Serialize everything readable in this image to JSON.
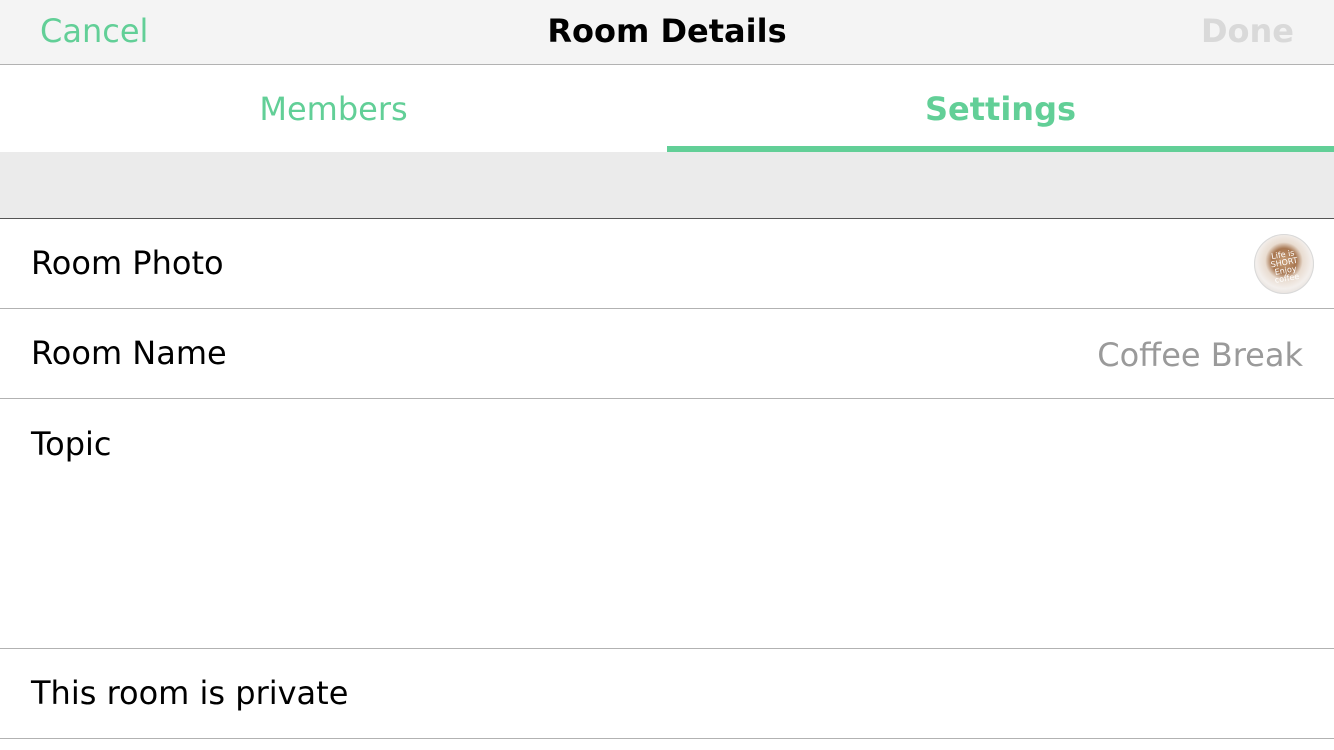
{
  "navbar": {
    "cancel_label": "Cancel",
    "title": "Room Details",
    "done_label": "Done"
  },
  "tabs": [
    {
      "label": "Members",
      "selected": false
    },
    {
      "label": "Settings",
      "selected": true
    }
  ],
  "settings": {
    "room_photo": {
      "label": "Room Photo",
      "avatar_text": "Life is SHORT Enjoy coffee"
    },
    "room_name": {
      "label": "Room Name",
      "value": "Coffee Break"
    },
    "topic": {
      "label": "Topic",
      "value": ""
    },
    "privacy": {
      "label": "This room is private"
    }
  },
  "colors": {
    "accent": "#62cf97",
    "disabled": "#d9d9d9",
    "secondary_text": "#9a9a9a",
    "nav_background": "#f4f4f4",
    "section_background": "#ebebeb"
  }
}
